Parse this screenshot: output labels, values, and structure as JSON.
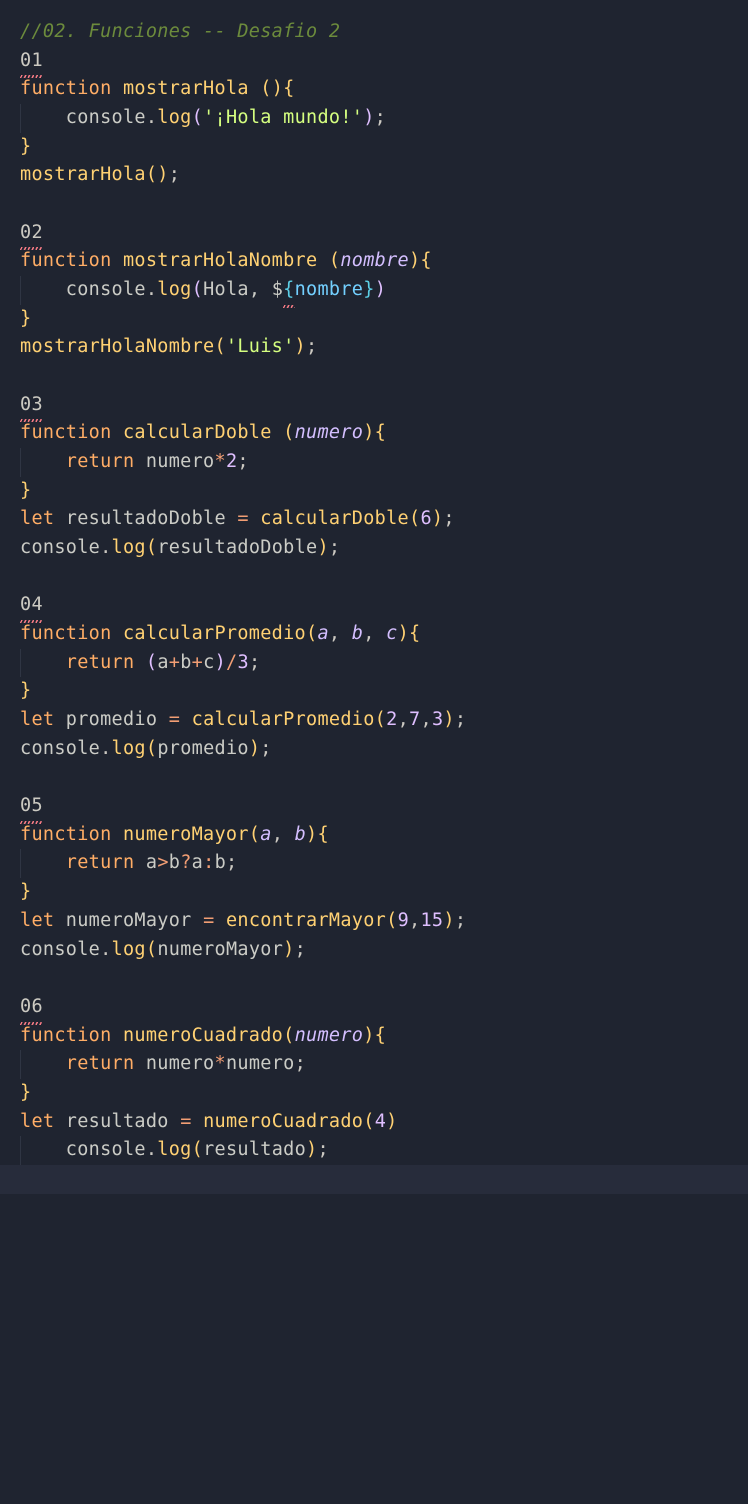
{
  "lines": {
    "comment": "//02. Funciones -- Desafio 2",
    "s1": "01",
    "s2": "02",
    "s3": "03",
    "s4": "04",
    "s5": "05",
    "s6": "06",
    "kw_function": "function",
    "kw_return": "return",
    "kw_let": "let",
    "fn_mostrarHola": "mostrarHola",
    "fn_mostrarHolaNombre": "mostrarHolaNombre",
    "fn_calcularDoble": "calcularDoble",
    "fn_calcularPromedio": "calcularPromedio",
    "fn_numeroMayor": "numeroMayor",
    "fn_encontrarMayor": "encontrarMayor",
    "fn_numeroCuadrado": "numeroCuadrado",
    "obj_console": "console",
    "method_log": "log",
    "str_holaMundo": "'¡Hola mundo!'",
    "str_luis": "'Luis'",
    "param_nombre": "nombre",
    "param_numero": "numero",
    "param_a": "a",
    "param_b": "b",
    "param_c": "c",
    "var_resultadoDoble": "resultadoDoble",
    "var_promedio": "promedio",
    "var_numeroMayor": "numeroMayor",
    "var_resultado": "resultado",
    "tmpl_hola": "Hola, $",
    "tmplvar_nombre": "nombre",
    "num_2": "2",
    "num_3": "3",
    "num_4": "4",
    "num_6": "6",
    "num_7": "7",
    "num_9": "9",
    "num_15": "15"
  }
}
